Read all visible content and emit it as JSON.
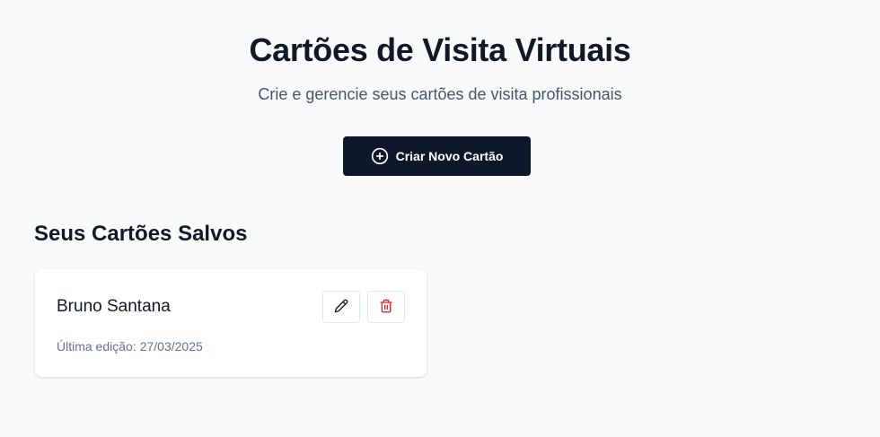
{
  "header": {
    "title": "Cartões de Visita Virtuais",
    "subtitle": "Crie e gerencie seus cartões de visita profissionais"
  },
  "create_button": {
    "label": "Criar Novo Cartão",
    "icon": "plus-circle-icon"
  },
  "saved_section": {
    "title": "Seus Cartões Salvos",
    "cards": [
      {
        "name": "Bruno Santana",
        "last_edit_label": "Última edição:",
        "last_edit_date": "27/03/2025",
        "actions": [
          {
            "icon": "pencil-icon",
            "color": "#0f172a"
          },
          {
            "icon": "trash-icon",
            "color": "#dc2626"
          }
        ]
      }
    ]
  },
  "colors": {
    "background": "#f8fafc",
    "primary": "#0f172a",
    "danger": "#dc2626",
    "muted_text": "#64748b"
  }
}
